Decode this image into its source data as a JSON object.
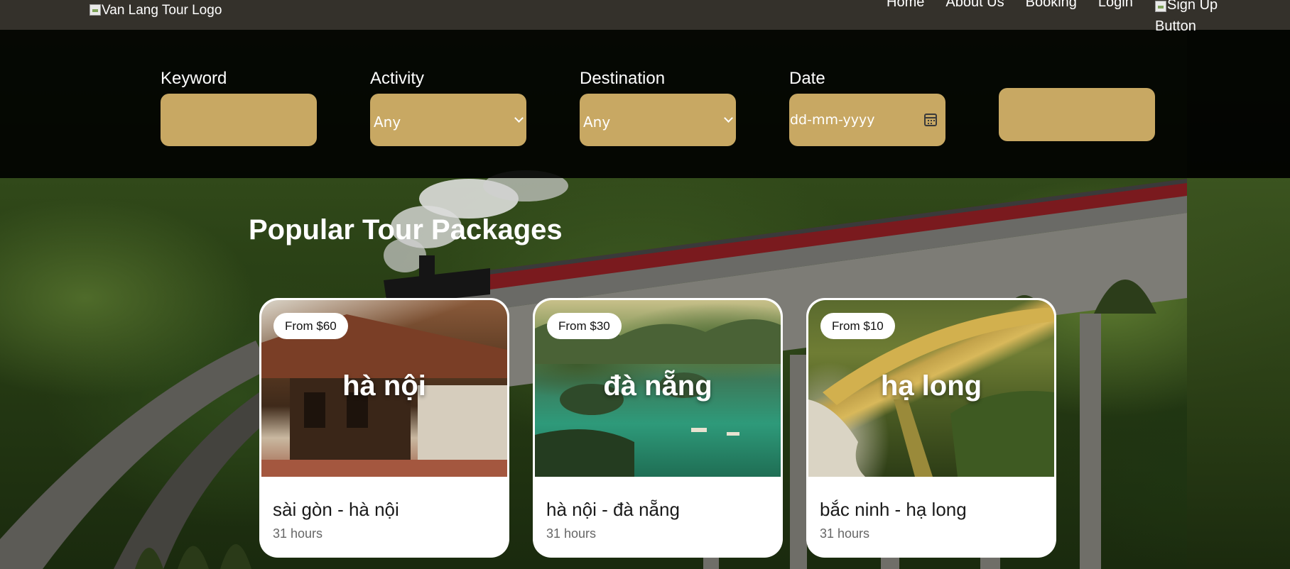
{
  "navbar": {
    "logo_alt": "Van Lang Tour Logo",
    "links": [
      "Home",
      "About Us",
      "Booking",
      "Login"
    ],
    "signup_alt": "Sign Up Button"
  },
  "search": {
    "keyword_label": "Keyword",
    "keyword_value": "",
    "activity_label": "Activity",
    "activity_selected": "Any",
    "destination_label": "Destination",
    "destination_selected": "Any",
    "date_label": "Date",
    "date_placeholder": "dd-mm-yyyy",
    "submit_label": ""
  },
  "section": {
    "title": "Popular Tour Packages"
  },
  "tours": [
    {
      "price": "From $60",
      "city": "hà nội",
      "route": "sài gòn - hà nội",
      "duration": "31 hours"
    },
    {
      "price": "From $30",
      "city": "đà nẵng",
      "route": "hà nội - đà nẵng",
      "duration": "31 hours"
    },
    {
      "price": "From $10",
      "city": "hạ long",
      "route": "bắc ninh - hạ long",
      "duration": "31 hours"
    }
  ],
  "colors": {
    "navbar_bg": "#34312b",
    "accent_gold": "#c8a863",
    "card_bg": "#ffffff"
  }
}
